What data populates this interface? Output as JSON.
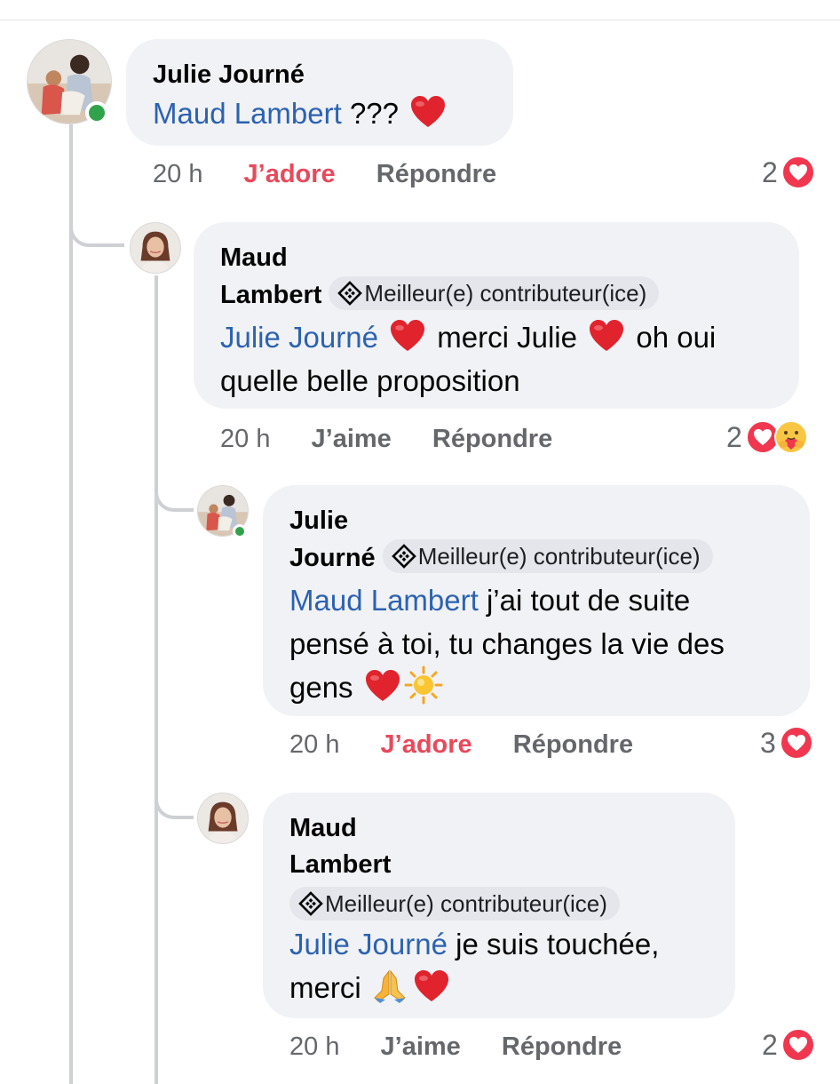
{
  "comments": [
    {
      "author": "Julie Journé",
      "mention": "Maud Lambert",
      "text": " ???",
      "time": "20 h",
      "like_label": "J’adore",
      "reply_label": "Répondre",
      "reaction_count": "2"
    },
    {
      "author_line1": "Maud",
      "author_line2": "Lambert",
      "badge": "Meilleur(e) contributeur(ice)",
      "mention": "Julie Journé",
      "text_a": " merci Julie ",
      "text_b": " oh oui",
      "text_c": "quelle belle proposition",
      "time": "20 h",
      "like_label": "J’aime",
      "reply_label": "Répondre",
      "reaction_count": "2"
    },
    {
      "author_line1": "Julie",
      "author_line2": "Journé",
      "badge": "Meilleur(e) contributeur(ice)",
      "mention": "Maud Lambert",
      "text_a": " j’ai tout de suite",
      "text_b": "pensé à toi, tu changes la vie des",
      "text_c": "gens ",
      "time": "20 h",
      "like_label": "J’adore",
      "reply_label": "Répondre",
      "reaction_count": "3"
    },
    {
      "author_line1": "Maud",
      "author_line2": "Lambert",
      "badge": "Meilleur(e) contributeur(ice)",
      "mention": "Julie Journé",
      "text_a": " je suis touchée,",
      "text_b": "merci ",
      "time": "20 h",
      "like_label": "J’aime",
      "reply_label": "Répondre",
      "reaction_count": "2"
    }
  ],
  "icons": {
    "heart": "red-heart-emoji",
    "love_reaction": "love-reaction-icon",
    "care_reaction": "care-reaction-icon",
    "sun": "sun-emoji",
    "pray": "folded-hands-emoji",
    "badge": "top-contributor-badge-icon"
  },
  "colors": {
    "mention": "#2d62b0",
    "loved": "#e8495b",
    "bubble": "#f0f2f5",
    "online": "#31a24c"
  }
}
